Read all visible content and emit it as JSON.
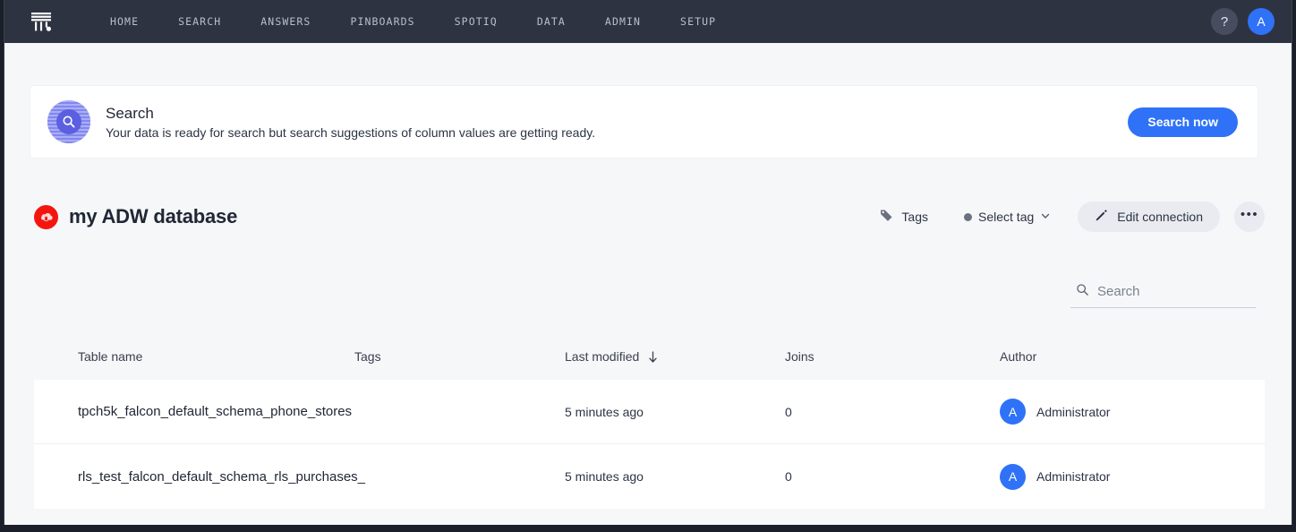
{
  "nav": {
    "logo_icon": "thoughtspot-logo-icon",
    "links": [
      {
        "label": "HOME"
      },
      {
        "label": "SEARCH"
      },
      {
        "label": "ANSWERS"
      },
      {
        "label": "PINBOARDS"
      },
      {
        "label": "SPOTIQ"
      },
      {
        "label": "DATA"
      },
      {
        "label": "ADMIN"
      },
      {
        "label": "SETUP"
      }
    ],
    "help_label": "?",
    "avatar_label": "A"
  },
  "banner": {
    "icon": "search-circle-icon",
    "title": "Search",
    "subtitle": "Your data is ready for search but search suggestions of column values are getting ready.",
    "cta_label": "Search now",
    "cta_color": "#2f72f7"
  },
  "page": {
    "db_icon": "oracle-adw-cloud-database-icon",
    "db_icon_color": "#f5150f",
    "title": "my ADW database",
    "actions": {
      "tags_label": "Tags",
      "tags_icon": "tag-icon",
      "select_tag_label": "Select tag",
      "select_tag_dot_color": "#6b7180",
      "chevron_icon": "chevron-down-icon",
      "edit_connection_label": "Edit connection",
      "edit_connection_icon": "pencil-icon",
      "more_label": "•••",
      "more_icon": "more-horizontal-icon"
    }
  },
  "search": {
    "icon": "search-icon",
    "placeholder": "Search",
    "value": ""
  },
  "table": {
    "columns": [
      {
        "key": "name",
        "label": "Table name"
      },
      {
        "key": "tags",
        "label": "Tags"
      },
      {
        "key": "modified",
        "label": "Last modified",
        "sort": "desc",
        "sort_icon": "arrow-down-icon"
      },
      {
        "key": "joins",
        "label": "Joins"
      },
      {
        "key": "author",
        "label": "Author"
      }
    ],
    "rows": [
      {
        "name": "tpch5k_falcon_default_schema_phone_stores",
        "tags": "",
        "modified": "5 minutes ago",
        "joins": "0",
        "author": "Administrator",
        "author_initial": "A"
      },
      {
        "name": "rls_test_falcon_default_schema_rls_purchases_",
        "tags": "",
        "modified": "5 minutes ago",
        "joins": "0",
        "author": "Administrator",
        "author_initial": "A"
      }
    ]
  }
}
